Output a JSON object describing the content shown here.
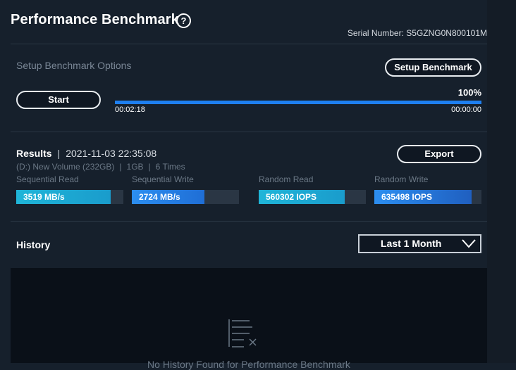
{
  "header": {
    "title": "Performance Benchmark",
    "help_glyph": "?",
    "serial": "Serial Number: S5GZNG0N800101M"
  },
  "setup": {
    "options_label": "Setup Benchmark Options",
    "setup_button": "Setup Benchmark",
    "start_button": "Start",
    "progress_percent": 100,
    "progress_label": "100%",
    "elapsed": "00:02:18",
    "remaining": "00:00:00"
  },
  "results": {
    "label": "Results",
    "separator": "|",
    "date": "2021-11-03 22:35:08",
    "volume": "(D:) New Volume (232GB)",
    "size": "1GB",
    "times": "6 Times",
    "export_button": "Export",
    "metrics": [
      {
        "name": "Sequential Read",
        "value": "3519 MB/s",
        "fill": 0.88,
        "color_start": "#1fb5d8",
        "color_end": "#1a9ccc"
      },
      {
        "name": "Sequential Write",
        "value": "2724 MB/s",
        "fill": 0.68,
        "color_start": "#2c8ef0",
        "color_end": "#1f6ed6"
      },
      {
        "name": "Random Read",
        "value": "560302 IOPS",
        "fill": 0.8,
        "color_start": "#1fb5d8",
        "color_end": "#1a9ccc"
      },
      {
        "name": "Random Write",
        "value": "635498 IOPS",
        "fill": 0.91,
        "color_start": "#2c8ef0",
        "color_end": "#1f5fc0"
      }
    ]
  },
  "history": {
    "title": "History",
    "range_selected": "Last 1 Month",
    "empty_icon": "list-clear-icon",
    "empty_text": "No History Found for Performance Benchmark"
  }
}
